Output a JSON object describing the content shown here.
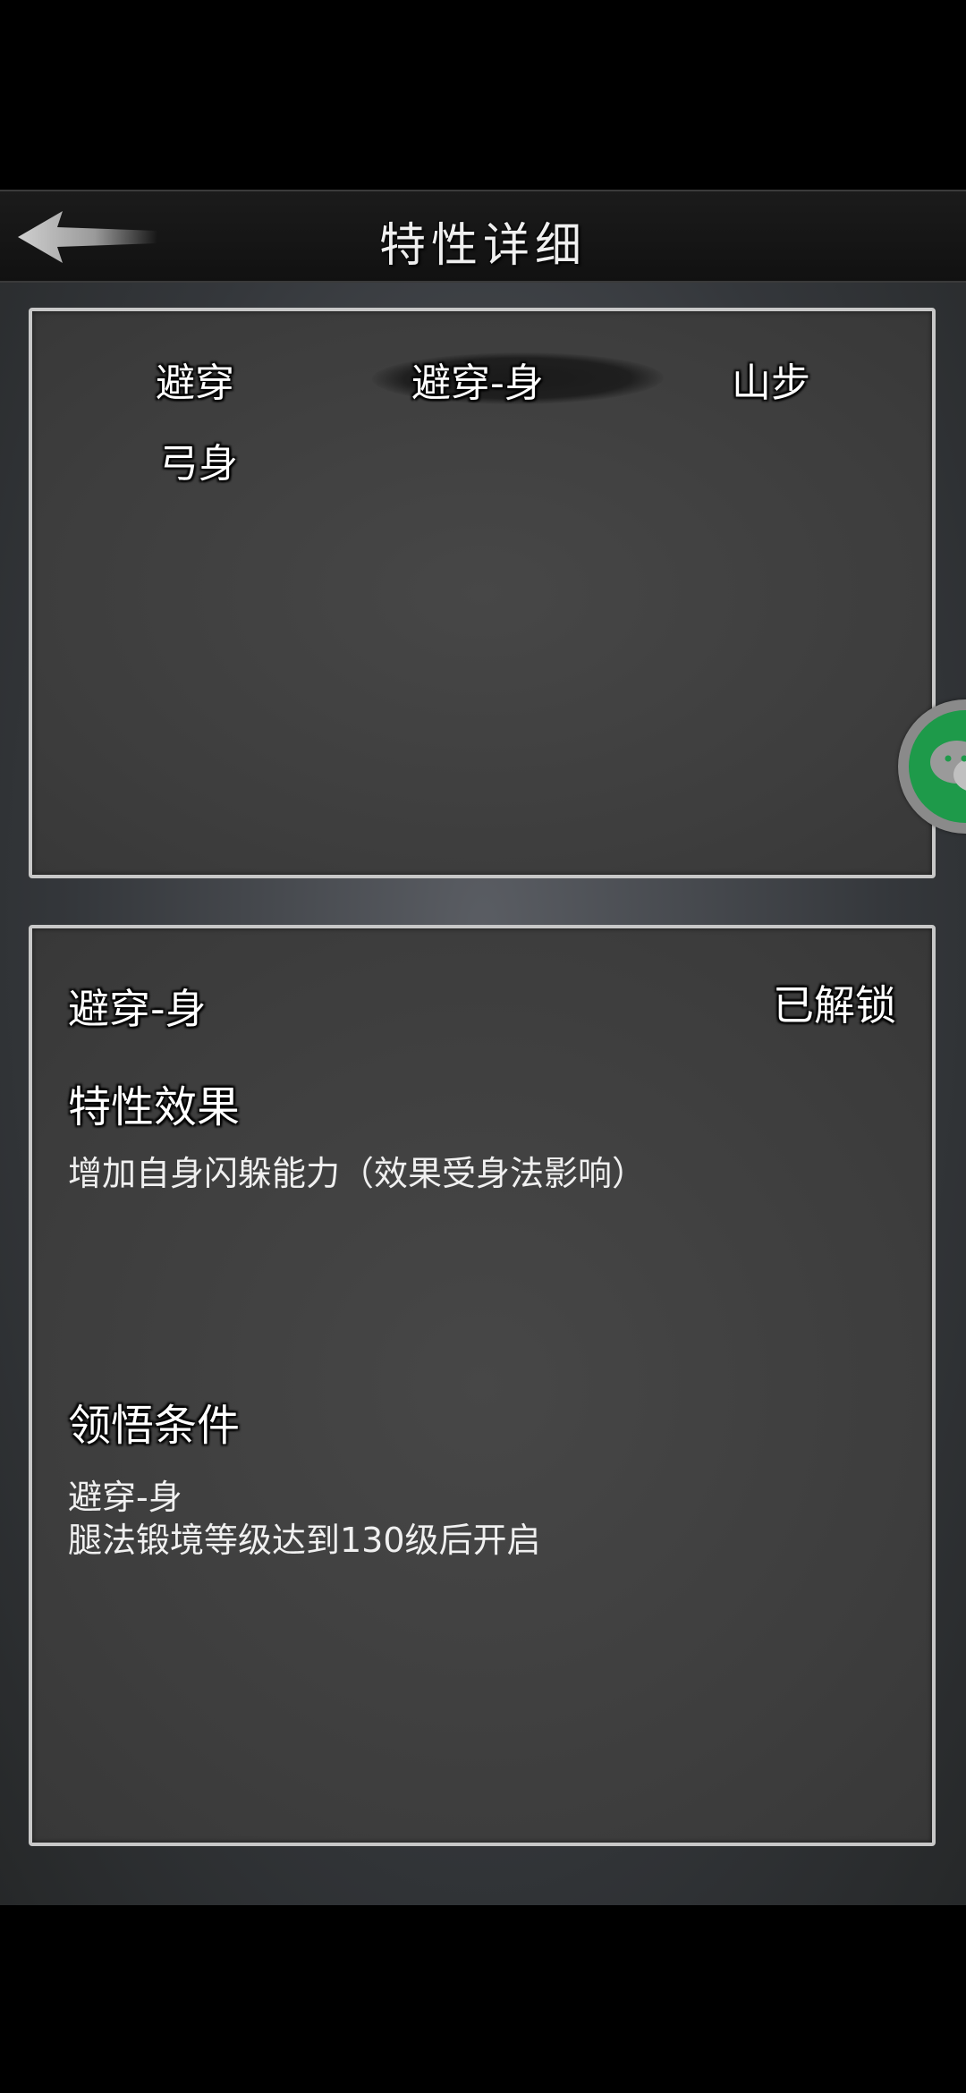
{
  "header": {
    "title": "特性详细",
    "back_icon": "back-arrow-icon"
  },
  "traits": {
    "items": [
      {
        "label": "避穿"
      },
      {
        "label": "避穿-身",
        "selected": true
      },
      {
        "label": "山步"
      },
      {
        "label": "弓身"
      }
    ]
  },
  "detail": {
    "name": "避穿-身",
    "status": "已解锁",
    "effect_heading": "特性效果",
    "effect_text": "增加自身闪躲能力（效果受身法影响）",
    "condition_heading": "领悟条件",
    "condition_line1": "避穿-身",
    "condition_line2": "腿法锻境等级达到130级后开启"
  },
  "floating": {
    "icon": "wechat-icon",
    "color": "#1e9a4a"
  }
}
